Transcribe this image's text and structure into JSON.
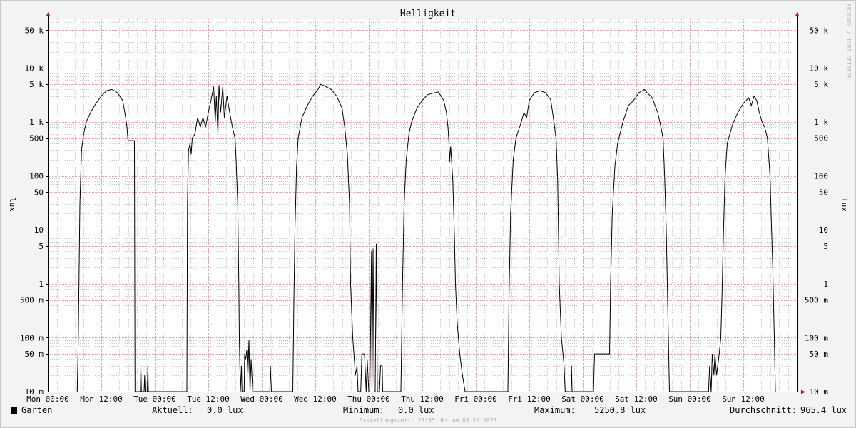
{
  "chart_data": {
    "type": "line",
    "title": "Helligkeit",
    "ylabel": "lux",
    "yscale": "log",
    "ylim": [
      0.01,
      80000
    ],
    "y_ticks": [
      {
        "value": 0.01,
        "label": "10 m"
      },
      {
        "value": 0.05,
        "label": "50 m"
      },
      {
        "value": 0.1,
        "label": "100 m"
      },
      {
        "value": 0.5,
        "label": "500 m"
      },
      {
        "value": 1,
        "label": "1"
      },
      {
        "value": 5,
        "label": "5"
      },
      {
        "value": 10,
        "label": "10"
      },
      {
        "value": 50,
        "label": "50"
      },
      {
        "value": 100,
        "label": "100"
      },
      {
        "value": 500,
        "label": "500"
      },
      {
        "value": 1000,
        "label": "1 k"
      },
      {
        "value": 5000,
        "label": "5 k"
      },
      {
        "value": 10000,
        "label": "10 k"
      },
      {
        "value": 50000,
        "label": "50 k"
      }
    ],
    "xlim": [
      0,
      14
    ],
    "x_unit": "half-days since Mon 00:00",
    "x_ticks": [
      {
        "value": 0,
        "label": "Mon 00:00"
      },
      {
        "value": 1,
        "label": "Mon 12:00"
      },
      {
        "value": 2,
        "label": "Tue 00:00"
      },
      {
        "value": 3,
        "label": "Tue 12:00"
      },
      {
        "value": 4,
        "label": "Wed 00:00"
      },
      {
        "value": 5,
        "label": "Wed 12:00"
      },
      {
        "value": 6,
        "label": "Thu 00:00"
      },
      {
        "value": 7,
        "label": "Thu 12:00"
      },
      {
        "value": 8,
        "label": "Fri 00:00"
      },
      {
        "value": 9,
        "label": "Fri 12:00"
      },
      {
        "value": 10,
        "label": "Sat 00:00"
      },
      {
        "value": 11,
        "label": "Sat 12:00"
      },
      {
        "value": 12,
        "label": "Sun 00:00"
      },
      {
        "value": 13,
        "label": "Sun 12:00"
      }
    ],
    "grid": true,
    "legend_position": "bottom-left",
    "series": [
      {
        "name": "Garten",
        "color": "#000000",
        "points": [
          [
            0.55,
            0.01
          ],
          [
            0.57,
            0.1
          ],
          [
            0.6,
            30
          ],
          [
            0.63,
            300
          ],
          [
            0.67,
            600
          ],
          [
            0.72,
            1000
          ],
          [
            0.8,
            1500
          ],
          [
            0.9,
            2200
          ],
          [
            1.0,
            3000
          ],
          [
            1.1,
            3800
          ],
          [
            1.2,
            4000
          ],
          [
            1.3,
            3500
          ],
          [
            1.4,
            2500
          ],
          [
            1.45,
            1300
          ],
          [
            1.48,
            800
          ],
          [
            1.5,
            450
          ],
          [
            1.62,
            450
          ],
          [
            1.63,
            0.01
          ],
          [
            1.73,
            0.01
          ],
          [
            1.74,
            0.03
          ],
          [
            1.75,
            0.01
          ],
          [
            1.8,
            0.01
          ],
          [
            1.81,
            0.02
          ],
          [
            1.82,
            0.01
          ],
          [
            1.86,
            0.01
          ],
          [
            1.87,
            0.03
          ],
          [
            1.88,
            0.01
          ],
          [
            2.6,
            0.01
          ],
          [
            2.61,
            30
          ],
          [
            2.63,
            300
          ],
          [
            2.66,
            400
          ],
          [
            2.68,
            250
          ],
          [
            2.7,
            500
          ],
          [
            2.75,
            600
          ],
          [
            2.8,
            1200
          ],
          [
            2.85,
            800
          ],
          [
            2.9,
            1200
          ],
          [
            2.95,
            800
          ],
          [
            3.0,
            1500
          ],
          [
            3.05,
            2500
          ],
          [
            3.1,
            4500
          ],
          [
            3.13,
            1000
          ],
          [
            3.15,
            3000
          ],
          [
            3.18,
            600
          ],
          [
            3.2,
            4800
          ],
          [
            3.23,
            1500
          ],
          [
            3.27,
            4500
          ],
          [
            3.3,
            1200
          ],
          [
            3.35,
            3000
          ],
          [
            3.4,
            1500
          ],
          [
            3.45,
            800
          ],
          [
            3.5,
            500
          ],
          [
            3.52,
            200
          ],
          [
            3.55,
            30
          ],
          [
            3.57,
            1
          ],
          [
            3.58,
            0.1
          ],
          [
            3.6,
            0.01
          ],
          [
            3.62,
            0.03
          ],
          [
            3.63,
            0.01
          ],
          [
            3.67,
            0.01
          ],
          [
            3.68,
            0.05
          ],
          [
            3.7,
            0.04
          ],
          [
            3.72,
            0.06
          ],
          [
            3.74,
            0.02
          ],
          [
            3.76,
            0.09
          ],
          [
            3.78,
            0.01
          ],
          [
            3.8,
            0.04
          ],
          [
            3.83,
            0.01
          ],
          [
            4.15,
            0.01
          ],
          [
            4.16,
            0.03
          ],
          [
            4.18,
            0.01
          ],
          [
            4.58,
            0.01
          ],
          [
            4.6,
            0.5
          ],
          [
            4.62,
            10
          ],
          [
            4.65,
            150
          ],
          [
            4.68,
            500
          ],
          [
            4.75,
            1200
          ],
          [
            4.85,
            2000
          ],
          [
            4.95,
            3000
          ],
          [
            5.05,
            4000
          ],
          [
            5.1,
            5000
          ],
          [
            5.2,
            4500
          ],
          [
            5.3,
            4000
          ],
          [
            5.4,
            3000
          ],
          [
            5.5,
            1800
          ],
          [
            5.55,
            800
          ],
          [
            5.6,
            250
          ],
          [
            5.64,
            30
          ],
          [
            5.66,
            1
          ],
          [
            5.7,
            0.1
          ],
          [
            5.75,
            0.02
          ],
          [
            5.78,
            0.03
          ],
          [
            5.8,
            0.01
          ],
          [
            5.85,
            0.01
          ],
          [
            5.87,
            0.05
          ],
          [
            5.92,
            0.05
          ],
          [
            5.95,
            0.01
          ],
          [
            5.97,
            0.04
          ],
          [
            6.0,
            0.01
          ],
          [
            6.02,
            0.01
          ],
          [
            6.05,
            4
          ],
          [
            6.06,
            0.01
          ],
          [
            6.08,
            4.5
          ],
          [
            6.1,
            0.01
          ],
          [
            6.12,
            0.01
          ],
          [
            6.14,
            5.5
          ],
          [
            6.16,
            0.01
          ],
          [
            6.2,
            0.01
          ],
          [
            6.22,
            0.03
          ],
          [
            6.25,
            0.03
          ],
          [
            6.26,
            0.01
          ],
          [
            6.6,
            0.01
          ],
          [
            6.63,
            1
          ],
          [
            6.66,
            30
          ],
          [
            6.7,
            200
          ],
          [
            6.75,
            600
          ],
          [
            6.8,
            1000
          ],
          [
            6.9,
            1800
          ],
          [
            7.0,
            2500
          ],
          [
            7.1,
            3200
          ],
          [
            7.2,
            3400
          ],
          [
            7.3,
            3600
          ],
          [
            7.35,
            3000
          ],
          [
            7.4,
            2500
          ],
          [
            7.45,
            1500
          ],
          [
            7.48,
            800
          ],
          [
            7.5,
            400
          ],
          [
            7.51,
            180
          ],
          [
            7.53,
            350
          ],
          [
            7.57,
            80
          ],
          [
            7.6,
            8
          ],
          [
            7.62,
            1
          ],
          [
            7.65,
            0.2
          ],
          [
            7.7,
            0.05
          ],
          [
            7.75,
            0.02
          ],
          [
            7.8,
            0.01
          ],
          [
            8.6,
            0.01
          ],
          [
            8.62,
            0.5
          ],
          [
            8.65,
            20
          ],
          [
            8.7,
            200
          ],
          [
            8.75,
            500
          ],
          [
            8.85,
            1000
          ],
          [
            8.9,
            1500
          ],
          [
            8.95,
            1200
          ],
          [
            9.0,
            2500
          ],
          [
            9.05,
            3000
          ],
          [
            9.1,
            3500
          ],
          [
            9.2,
            3800
          ],
          [
            9.3,
            3500
          ],
          [
            9.4,
            2600
          ],
          [
            9.45,
            1200
          ],
          [
            9.5,
            500
          ],
          [
            9.53,
            80
          ],
          [
            9.56,
            1
          ],
          [
            9.6,
            0.1
          ],
          [
            9.65,
            0.03
          ],
          [
            9.67,
            0.01
          ],
          [
            9.78,
            0.01
          ],
          [
            9.79,
            0.03
          ],
          [
            9.8,
            0.01
          ],
          [
            10.2,
            0.01
          ],
          [
            10.22,
            0.05
          ],
          [
            10.5,
            0.05
          ],
          [
            10.52,
            1
          ],
          [
            10.55,
            20
          ],
          [
            10.6,
            150
          ],
          [
            10.65,
            400
          ],
          [
            10.75,
            1000
          ],
          [
            10.85,
            2000
          ],
          [
            10.95,
            2500
          ],
          [
            11.05,
            3500
          ],
          [
            11.15,
            4000
          ],
          [
            11.2,
            3500
          ],
          [
            11.3,
            2800
          ],
          [
            11.35,
            2000
          ],
          [
            11.4,
            1500
          ],
          [
            11.45,
            900
          ],
          [
            11.5,
            500
          ],
          [
            11.53,
            100
          ],
          [
            11.56,
            10
          ],
          [
            11.58,
            1
          ],
          [
            11.6,
            0.1
          ],
          [
            11.62,
            0.01
          ],
          [
            12.35,
            0.01
          ],
          [
            12.37,
            0.03
          ],
          [
            12.4,
            0.01
          ],
          [
            12.42,
            0.05
          ],
          [
            12.45,
            0.02
          ],
          [
            12.47,
            0.05
          ],
          [
            12.5,
            0.02
          ],
          [
            12.55,
            0.05
          ],
          [
            12.58,
            0.1
          ],
          [
            12.6,
            0.5
          ],
          [
            12.63,
            10
          ],
          [
            12.66,
            100
          ],
          [
            12.7,
            400
          ],
          [
            12.8,
            900
          ],
          [
            12.9,
            1500
          ],
          [
            13.0,
            2200
          ],
          [
            13.1,
            2800
          ],
          [
            13.15,
            2000
          ],
          [
            13.2,
            3000
          ],
          [
            13.25,
            2500
          ],
          [
            13.3,
            1500
          ],
          [
            13.35,
            1000
          ],
          [
            13.4,
            800
          ],
          [
            13.45,
            500
          ],
          [
            13.5,
            100
          ],
          [
            13.52,
            20
          ],
          [
            13.55,
            2
          ],
          [
            13.58,
            0.1
          ],
          [
            13.6,
            0.01
          ]
        ]
      }
    ]
  },
  "legend": {
    "series_name": "Garten",
    "series_color": "#000000",
    "current_label": "Aktuell:",
    "current_value": "0.0 lux",
    "min_label": "Minimum:",
    "min_value": "0.0 lux",
    "max_label": "Maximum:",
    "max_value": "5250.8 lux",
    "avg_label": "Durchschnitt:",
    "avg_value": "965.4 lux"
  },
  "footer": {
    "created": "Erstellungszeit: 23:55 Uhr am 08.10.2023"
  },
  "watermark": "RRDTOOL / TOBI OETIKER",
  "colors": {
    "background": "#f3f3f3",
    "plot_background": "#ffffff",
    "major_grid": "#e8a0a0",
    "minor_grid": "#c8c8c8",
    "line": "#000000",
    "arrow": "#a02020"
  }
}
